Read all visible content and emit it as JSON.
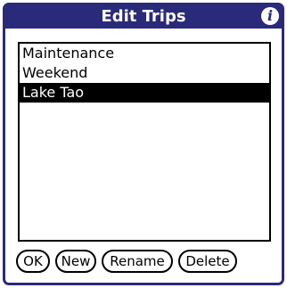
{
  "dialog": {
    "title": "Edit Trips",
    "info_icon": "info-icon"
  },
  "trips": {
    "items": [
      {
        "label": "Maintenance",
        "selected": false
      },
      {
        "label": "Weekend",
        "selected": false
      },
      {
        "label": "Lake Tao",
        "selected": true
      }
    ]
  },
  "buttons": {
    "ok": "OK",
    "new": "New",
    "rename": "Rename",
    "delete": "Delete"
  },
  "colors": {
    "titlebar": "#2a2a7a",
    "selection": "#000000"
  }
}
